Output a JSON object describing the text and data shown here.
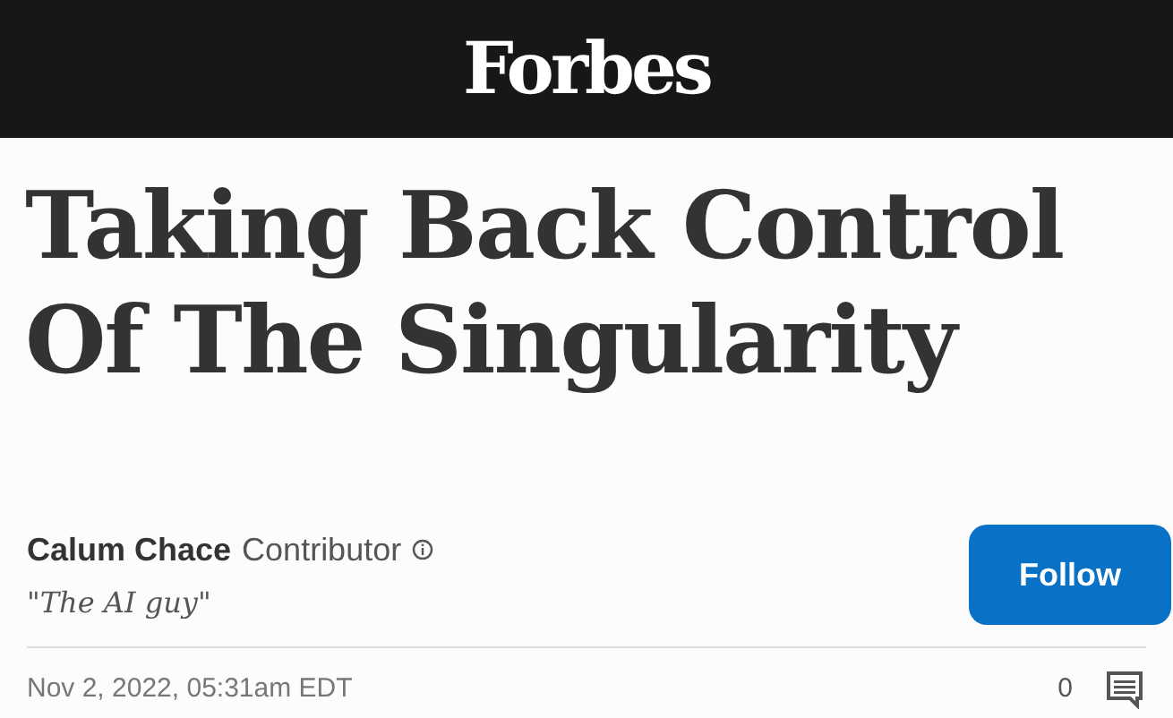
{
  "header": {
    "logo": "Forbes"
  },
  "article": {
    "title": "Taking Back Control Of The Singularity"
  },
  "author": {
    "name": "Calum Chace",
    "role": "Contributor",
    "tagline": "\"The AI guy\"",
    "follow_button": "Follow"
  },
  "meta": {
    "date": "Nov 2, 2022, 05:31am EDT",
    "comment_count": "0"
  }
}
